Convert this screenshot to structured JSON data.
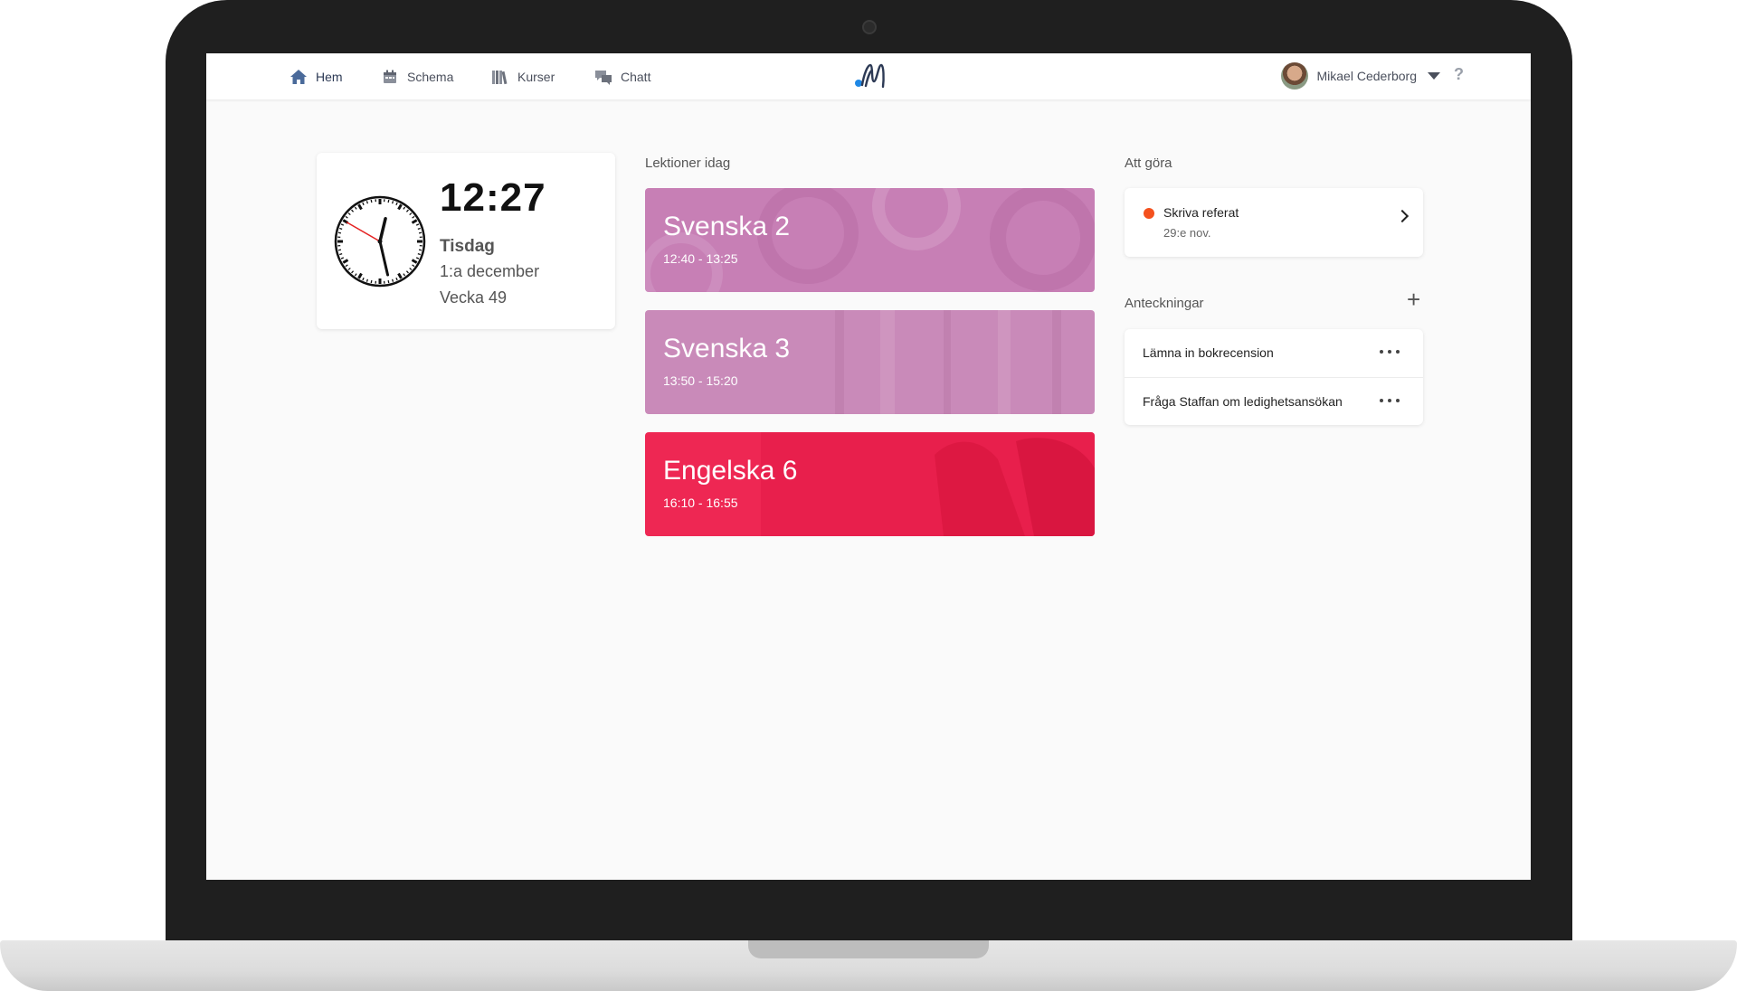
{
  "nav": {
    "items": [
      {
        "label": "Hem",
        "icon": "home-icon",
        "active": true
      },
      {
        "label": "Schema",
        "icon": "calendar-icon",
        "active": false
      },
      {
        "label": "Kurser",
        "icon": "books-icon",
        "active": false
      },
      {
        "label": "Chatt",
        "icon": "chat-icon",
        "active": false
      }
    ],
    "user_name": "Mikael Cederborg",
    "help_label": "?"
  },
  "clock": {
    "time": "12:27",
    "day": "Tisdag",
    "date": "1:a december",
    "week": "Vecka 49",
    "hours": 12,
    "minutes": 27,
    "seconds": 50
  },
  "lessons": {
    "title": "Lektioner idag",
    "items": [
      {
        "name": "Svenska 2",
        "time": "12:40 - 13:25",
        "color": "#c77fb5"
      },
      {
        "name": "Svenska 3",
        "time": "13:50 - 15:20",
        "color": "#c98ab9"
      },
      {
        "name": "Engelska 6",
        "time": "16:10 - 16:55",
        "color": "#e8214d"
      }
    ]
  },
  "todo": {
    "title": "Att göra",
    "items": [
      {
        "title": "Skriva referat",
        "date": "29:e nov.",
        "status_color": "#f4511e"
      }
    ]
  },
  "notes": {
    "title": "Anteckningar",
    "add_label": "+",
    "items": [
      {
        "text": "Lämna in bokrecension"
      },
      {
        "text": "Fråga Staffan om ledighetsansökan"
      }
    ]
  },
  "colors": {
    "accent": "#2d3a55",
    "logo_blue": "#1e88e5",
    "lesson_pink": "#c77fb5",
    "lesson_red": "#e8214d"
  }
}
